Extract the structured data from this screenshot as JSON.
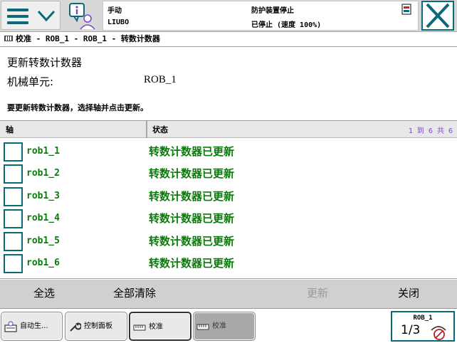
{
  "topbar": {
    "mode": "手动",
    "controller_name": "LIUBO",
    "guard_status": "防护装置停止",
    "run_state": "已停止 (速度 100%)",
    "menu_icon": "hamburger-menu-icon",
    "info_icon": "info-person-icon",
    "close_icon": "close-x-icon",
    "accent_color": "#0b6a78"
  },
  "breadcrumb": "校准 - ROB_1 - ROB_1 - 转数计数器",
  "page": {
    "title": "更新转数计数器",
    "unit_label": "机械单元:",
    "unit_value": "ROB_1",
    "instruction": "要更新转数计数器，选择轴并点击更新。"
  },
  "table": {
    "col_axis": "轴",
    "col_status": "状态",
    "count_text": "1 到 6 共 6",
    "rows": [
      {
        "axis": "rob1_1",
        "status": "转数计数器已更新"
      },
      {
        "axis": "rob1_2",
        "status": "转数计数器已更新"
      },
      {
        "axis": "rob1_3",
        "status": "转数计数器已更新"
      },
      {
        "axis": "rob1_4",
        "status": "转数计数器已更新"
      },
      {
        "axis": "rob1_5",
        "status": "转数计数器已更新"
      },
      {
        "axis": "rob1_6",
        "status": "转数计数器已更新"
      }
    ],
    "status_color": "#0a7a0a"
  },
  "actions": {
    "select_all": "全选",
    "clear_all": "全部清除",
    "update": "更新",
    "close": "关闭"
  },
  "taskbar": {
    "tasks": [
      {
        "label": "自动生...",
        "icon": "auto-production-icon"
      },
      {
        "label": "控制面板",
        "icon": "wrench-icon"
      },
      {
        "label": "校准",
        "icon": "calibration-icon"
      },
      {
        "label": "校准",
        "icon": "calibration-icon"
      }
    ],
    "robot": {
      "name": "ROB_1",
      "fraction": "1/3",
      "icon": "mechanical-unit-icon"
    }
  }
}
